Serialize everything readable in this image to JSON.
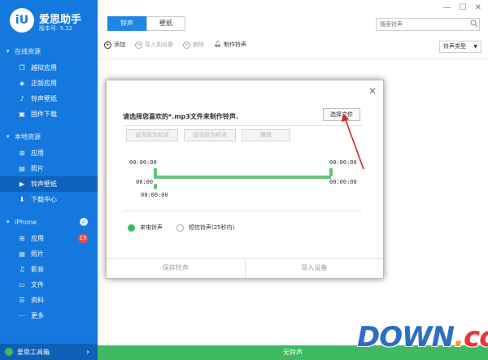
{
  "app": {
    "logo_text": "iU",
    "name": "爱思助手",
    "version": "版本号: 5.32"
  },
  "sidebar": {
    "sections": [
      {
        "label": "在线资源"
      },
      {
        "label": "本地资源"
      },
      {
        "label": "iPhone"
      }
    ],
    "online": [
      {
        "label": "越狱应用",
        "icon": "box-icon"
      },
      {
        "label": "正版应用",
        "icon": "app-store-icon"
      },
      {
        "label": "铃声壁纸",
        "icon": "music-icon"
      },
      {
        "label": "固件下载",
        "icon": "firmware-icon"
      }
    ],
    "local": [
      {
        "label": "应用",
        "icon": "apps-icon"
      },
      {
        "label": "照片",
        "icon": "photo-icon"
      },
      {
        "label": "铃声壁纸",
        "icon": "film-icon",
        "active": true
      },
      {
        "label": "下载中心",
        "icon": "download-icon"
      }
    ],
    "iphone": [
      {
        "label": "应用",
        "icon": "apps-icon",
        "badge": "15"
      },
      {
        "label": "照片",
        "icon": "photo-icon"
      },
      {
        "label": "影音",
        "icon": "media-icon"
      },
      {
        "label": "文件",
        "icon": "folder-icon"
      },
      {
        "label": "资料",
        "icon": "list-icon"
      },
      {
        "label": "更多",
        "icon": "more-icon"
      }
    ],
    "toolbox_label": "爱思工具箱"
  },
  "header": {
    "tabs": [
      {
        "label": "铃声",
        "active": true
      },
      {
        "label": "壁纸",
        "active": false
      }
    ],
    "search_placeholder": "搜索铃声",
    "window_controls": [
      "—",
      "☐",
      "✕"
    ]
  },
  "toolbar": {
    "actions": [
      {
        "label": "添加",
        "icon": "plus-icon",
        "enabled": true
      },
      {
        "label": "导入到设备",
        "icon": "import-icon",
        "enabled": false
      },
      {
        "label": "删除",
        "icon": "delete-icon",
        "enabled": false
      },
      {
        "label": "制作铃声",
        "icon": "bell-icon",
        "enabled": true
      }
    ],
    "type_select": "铃声类型"
  },
  "dialog": {
    "prompt": "请选择您喜欢的*.mp3文件来制作铃声.",
    "choose_file": "选择文件",
    "controls": [
      "设当前为起点",
      "设当前为终点",
      "播放"
    ],
    "times": {
      "start_top": "00:00:00",
      "end_top": "00:00:00",
      "start_mid": "00:00",
      "start_bottom": "00:00:00",
      "end_bottom": "00:00:00"
    },
    "radios": [
      {
        "label": "来电铃声",
        "checked": true
      },
      {
        "label": "短信铃声(25秒内)",
        "checked": false
      }
    ],
    "footer": [
      "保存铃声",
      "导入设备"
    ]
  },
  "status": {
    "text": "无铃声"
  },
  "watermark": {
    "text": "DOWN.cc",
    "main": "DOWN",
    "dot": ".",
    "suffix": "cc"
  },
  "colors": {
    "sidebar": "#1478de",
    "accent": "#1f86e4",
    "status": "#3fba62",
    "track": "#66c17a",
    "badge": "#ef4b4b"
  }
}
